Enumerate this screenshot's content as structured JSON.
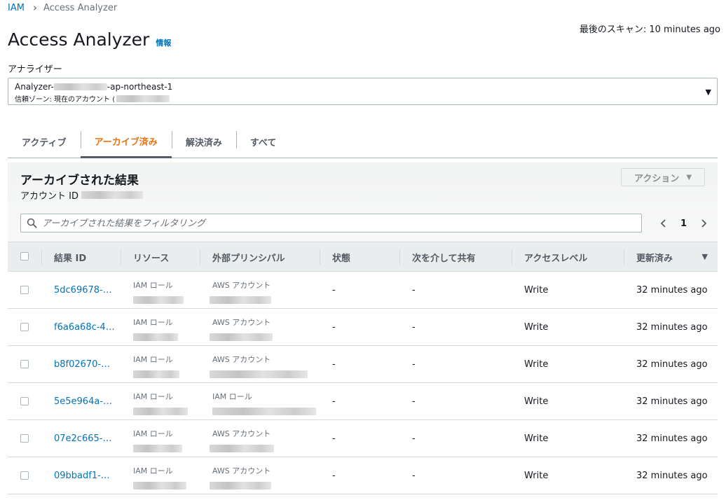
{
  "breadcrumb": {
    "root": "IAM",
    "separator": "›",
    "current": "Access Analyzer"
  },
  "last_scan": "最後のスキャン: 10 minutes ago",
  "page": {
    "title": "Access Analyzer",
    "info": "情報"
  },
  "analyzer": {
    "label": "アナライザー",
    "name_prefix": "Analyzer-",
    "name_suffix": "-ap-northeast-1",
    "zone_prefix": "信頼ゾーン: 現在のアカウント ("
  },
  "tabs": [
    {
      "label": "アクティブ",
      "active": false
    },
    {
      "label": "アーカイブ済み",
      "active": true
    },
    {
      "label": "解決済み",
      "active": false
    },
    {
      "label": "すべて",
      "active": false
    }
  ],
  "panel": {
    "title": "アーカイブされた結果",
    "account_label": "アカウント ID",
    "actions_label": "アクション",
    "filter_placeholder": "アーカイブされた結果をフィルタリング",
    "page": "1"
  },
  "columns": {
    "finding_id": "結果 ID",
    "resource": "リソース",
    "principal": "外部プリンシパル",
    "status": "状態",
    "shared_via": "次を介して共有",
    "access_level": "アクセスレベル",
    "updated": "更新済み"
  },
  "rows": [
    {
      "id": "5dc69678-…",
      "resource_type": "IAM ロール",
      "principal_type": "AWS アカウント",
      "status": "-",
      "shared_via": "-",
      "access": "Write",
      "updated": "32 minutes ago"
    },
    {
      "id": "f6a6a68c-4…",
      "resource_type": "IAM ロール",
      "principal_type": "AWS アカウント",
      "status": "-",
      "shared_via": "-",
      "access": "Write",
      "updated": "32 minutes ago"
    },
    {
      "id": "b8f02670-…",
      "resource_type": "IAM ロール",
      "principal_type": "AWS アカウント",
      "status": "-",
      "shared_via": "-",
      "access": "Write",
      "updated": "32 minutes ago"
    },
    {
      "id": "5e5e964a-…",
      "resource_type": "IAM ロール",
      "principal_type": "IAM ロール",
      "status": "-",
      "shared_via": "-",
      "access": "Write",
      "updated": "32 minutes ago"
    },
    {
      "id": "07e2c665-…",
      "resource_type": "IAM ロール",
      "principal_type": "AWS アカウント",
      "status": "-",
      "shared_via": "-",
      "access": "Write",
      "updated": "32 minutes ago"
    },
    {
      "id": "09bbadf1-…",
      "resource_type": "IAM ロール",
      "principal_type": "AWS アカウント",
      "status": "-",
      "shared_via": "-",
      "access": "Write",
      "updated": "32 minutes ago"
    }
  ],
  "icons": {
    "search": "search-icon",
    "prev": "chevron-left-icon",
    "next": "chevron-right-icon",
    "dropdown": "caret-down-icon"
  },
  "colors": {
    "link": "#0073bb",
    "active_tab": "#ec7211"
  }
}
